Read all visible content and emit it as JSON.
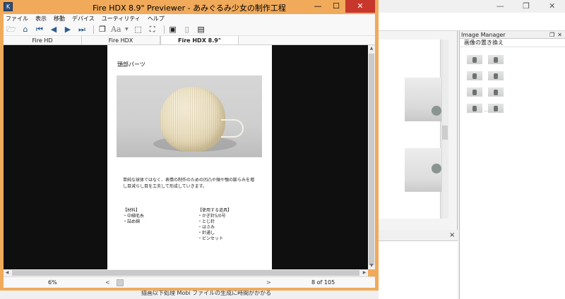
{
  "window": {
    "title": "Fire HDX 8.9\" Previewer - あみぐるみ少女の制作工程",
    "app_icon": "app-icon",
    "controls": [
      "minimize-icon",
      "maximize-icon",
      "close-icon"
    ]
  },
  "menu": [
    "ファイル",
    "表示",
    "移動",
    "デバイス",
    "ユーティリティ",
    "ヘルプ"
  ],
  "toolbar": {
    "aa_label": "Aa",
    "icons": [
      "open-folder-icon",
      "home-icon",
      "first-page-icon",
      "previous-page-icon",
      "next-page-icon",
      "last-page-icon",
      "copy-icon",
      "font-size-icon",
      "fit-page-icon",
      "fullscreen-icon",
      "portrait-icon",
      "page-icon",
      "document-icon"
    ]
  },
  "tabs": [
    "Fire HD",
    "Fire HDX",
    "Fire HDX 8.9\""
  ],
  "active_tab": "Fire HDX 8.9\"",
  "page": {
    "heading": "頭部パーツ",
    "paragraph_line1": "単純な球体ではなく、表情の制作のための凹凸や頬や顎の膨らみを増",
    "paragraph_line2": "し目減らし目を工夫して形成していきます。",
    "materials": [
      "【材料】",
      "・中細毛糸",
      "・詰め綿"
    ],
    "tools": [
      "【使用する道具】",
      "・かぎ針5/0号",
      "・とじ針",
      "・はさみ",
      "・針通し",
      "・ピンセット"
    ]
  },
  "status": {
    "zoom": "6%",
    "scroll_left": "<",
    "scroll_right": ">",
    "page_indicator": "8 of 105"
  },
  "image_manager": {
    "title": "Image Manager",
    "subtitle": "画像の置き換え",
    "icons": [
      "restore-icon",
      "close-icon"
    ]
  },
  "background": {
    "panel_close": "×",
    "bottom_text": "描画以下処理 Mobi ファイルの生成に時間がかかる"
  },
  "colors": {
    "window_frame": "#f0aa5a",
    "close_button": "#c7372c",
    "viewer_bg": "#0f0f0f",
    "toolbar_icon": "#2a5d8f"
  }
}
